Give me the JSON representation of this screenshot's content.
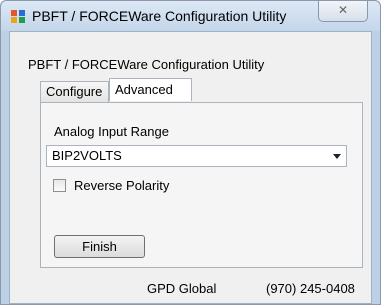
{
  "window": {
    "title": "PBFT / FORCEWare Configuration Utility",
    "close_glyph": "✕",
    "icon": "app-grid-icon"
  },
  "content": {
    "group_title": "PBFT / FORCEWare Configuration Utility",
    "tabs": [
      {
        "label": "Configure",
        "active": false
      },
      {
        "label": "Advanced",
        "active": true
      }
    ],
    "advanced": {
      "analog_range_label": "Analog Input Range",
      "analog_range_value": "BIP2VOLTS",
      "reverse_polarity_label": "Reverse Polarity",
      "reverse_polarity_checked": false,
      "finish_label": "Finish"
    }
  },
  "footer": {
    "company": "GPD Global",
    "phone": "(970) 245-0408"
  },
  "colors": {
    "title_bar": "#c9dbef",
    "window_frame": "#bcd0e6",
    "client_bg": "#f0f0f0"
  }
}
